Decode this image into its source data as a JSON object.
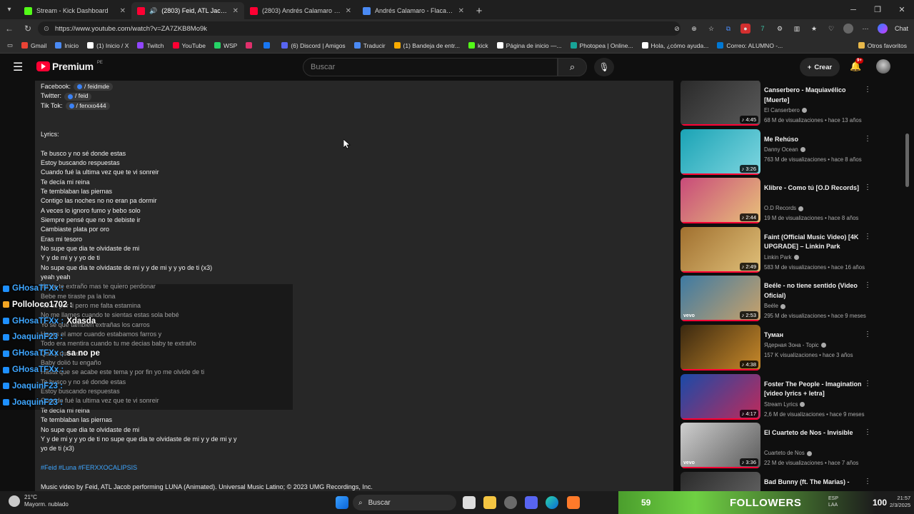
{
  "browser": {
    "tabs": [
      {
        "title": "Stream - Kick Dashboard",
        "icon": "kick-icon",
        "color": "#53fc18",
        "active": false
      },
      {
        "title": "(2803) Feid, ATL Jacob - Luna",
        "icon": "youtube-icon",
        "color": "#ff0033",
        "active": true
      },
      {
        "title": "(2803) Andrés Calamaro - Flaca (V",
        "icon": "youtube-icon",
        "color": "#ff0033",
        "active": false
      },
      {
        "title": "Andrés Calamaro - Flaca letra - Bú",
        "icon": "search-icon",
        "color": "#4a8af4",
        "active": false
      }
    ],
    "url": "https://www.youtube.com/watch?v=ZA7ZKB8Mo9k",
    "chat_label": "Chat",
    "bookmarks": [
      {
        "label": "Gmail",
        "color": "#ea4335"
      },
      {
        "label": "Inicio",
        "color": "#4a8af4"
      },
      {
        "label": "(1) Inicio / X",
        "color": "#ffffff"
      },
      {
        "label": "Twitch",
        "color": "#9146ff"
      },
      {
        "label": "YouTube",
        "color": "#ff0033"
      },
      {
        "label": "WSP",
        "color": "#25d366"
      },
      {
        "label": "",
        "color": "#e1306c"
      },
      {
        "label": "",
        "color": "#1877f2"
      },
      {
        "label": "(6) Discord | Amigos",
        "color": "#5865f2"
      },
      {
        "label": "Traducir",
        "color": "#4a8af4"
      },
      {
        "label": "(1) Bandeja de entr...",
        "color": "#f9ab00"
      },
      {
        "label": "kick",
        "color": "#53fc18"
      },
      {
        "label": "Página de inicio —...",
        "color": "#ffffff"
      },
      {
        "label": "Photopea | Online...",
        "color": "#18a497"
      },
      {
        "label": "Hola, ¿cómo ayuda...",
        "color": "#ffffff"
      },
      {
        "label": "Correo: ALUMNO -...",
        "color": "#0078d4"
      }
    ],
    "other_favorites": "Otros favoritos"
  },
  "youtube": {
    "logo": "Premium",
    "region": "PE",
    "search_placeholder": "Buscar",
    "create_label": "Crear",
    "notif_count": "9+"
  },
  "description": {
    "social": [
      {
        "label": "Facebook:",
        "chip": "/ feidmde"
      },
      {
        "label": "Twitter:",
        "chip": "/ feid"
      },
      {
        "label": "Tik Tok:",
        "chip": "/ ferxxo444"
      }
    ],
    "lyrics_heading": "Lyrics:",
    "lyrics": [
      "Te busco y no sé donde estas",
      "Estoy buscando respuestas",
      "Cuando fué la ultima vez que te vi sonreir",
      "Te decía mi reina",
      "Te temblaban las piernas",
      "Contigo las noches no no eran pa dormir",
      "A veces lo ignoro fumo y bebo solo",
      "Siempre pensé que no te debiste ir",
      "Cambiaste plata por oro",
      "Eras mi tesoro",
      "No supe que dia te olvidaste de mi",
      "Y y de mi y y yo de ti",
      "No supe que dia te olvidaste de mi y y de mi y y yo de ti (x3)",
      "yeah yeah",
      "Ya no te extraño mas te quiero perdonar",
      "Bebe me tiraste pa la lona",
      "No es por ti pero me falta estamina",
      "No me llames cuando te sientas estas sola bebé",
      "Yo se que también extrañas los carros",
      "Haces el amor cuando estabamos farros y",
      "Todo era mentira cuando tu me decias baby te extraño",
      "Que y que bebé",
      "Baby dolió tu engaño",
      "Hasta que se acabe este tema y por fin yo me olvide de ti",
      "Te busco y no sé donde estas",
      "Estoy buscando respuestas",
      "Cuando fué la ultima vez que te vi sonreir",
      "Te decía mi reina",
      "Te temblaban las piernas",
      "No supe que dia te olvidaste de mi",
      "Y y de mi y y yo de ti no supe que dia te olvidaste de mi y y de mi y y",
      "yo de ti (x3)"
    ],
    "hashtags": "#Feid #Luna #FERXXOCALIPSIS",
    "footer": "Music video by Feid, ATL Jacob performing LUNA (Animated). Universal Music Latino; © 2023 UMG Recordings, Inc."
  },
  "recommendations": [
    {
      "title": "Canserbero - Maquiavélico [Muerte]",
      "channel": "El Canserbero",
      "meta": "68 M de visualizaciones • hace 13 años",
      "duration": "4:45",
      "colors": [
        "#2a2a2a",
        "#5a5a5a"
      ],
      "vevo": false
    },
    {
      "title": "Me Rehúso",
      "channel": "Danny Ocean",
      "meta": "763 M de visualizaciones • hace 8 años",
      "duration": "3:26",
      "colors": [
        "#1aa3b5",
        "#7fd6e0"
      ],
      "vevo": false
    },
    {
      "title": "Klibre - Como tú [O.D Records]",
      "channel": "O.D Records",
      "meta": "19 M de visualizaciones • hace 8 años",
      "duration": "2:44",
      "colors": [
        "#c84a7a",
        "#e8c27a"
      ],
      "vevo": false
    },
    {
      "title": "Faint (Official Music Video) [4K UPGRADE] – Linkin Park",
      "channel": "Linkin Park",
      "meta": "583 M de visualizaciones • hace 16 años",
      "duration": "2:49",
      "colors": [
        "#a0702f",
        "#e0c07a"
      ],
      "vevo": false
    },
    {
      "title": "Beéle - no tiene sentido (Video Oficial)",
      "channel": "Beéle",
      "meta": "295 M de visualizaciones • hace 9 meses",
      "duration": "2:53",
      "colors": [
        "#3d7aa3",
        "#c9a26a"
      ],
      "vevo": true
    },
    {
      "title": "Туман",
      "channel": "Ядерная Зона - Topic",
      "meta": "157 K visualizaciones • hace 3 años",
      "duration": "4:38",
      "colors": [
        "#3a2810",
        "#c98a2a"
      ],
      "vevo": false
    },
    {
      "title": "Foster The People - Imagination [video lyrics + letra]",
      "channel": "Stream Lyrics",
      "meta": "2,6 M de visualizaciones • hace 9 meses",
      "duration": "4:17",
      "colors": [
        "#1a4aa8",
        "#c02a5a"
      ],
      "vevo": false
    },
    {
      "title": "El Cuarteto de Nos - Invisible",
      "channel": "Cuarteto de Nos",
      "meta": "22 M de visualizaciones • hace 7 años",
      "duration": "3:36",
      "colors": [
        "#cfcfcf",
        "#5a5a5a"
      ],
      "vevo": true
    },
    {
      "title": "Bad Bunny (ft. The Marias) -",
      "channel": "",
      "meta": "",
      "duration": "",
      "colors": [
        "#2a2a2a",
        "#6a6a6a"
      ],
      "vevo": false
    }
  ],
  "chat_overlay": [
    {
      "user": "GHosaTFXx :",
      "msg": "",
      "color": "#3ea6ff",
      "badge": "#1e90ff"
    },
    {
      "user": "Polloloco1702 :",
      "msg": "",
      "color": "#ffffff",
      "badge": "#f5a623"
    },
    {
      "user": "GHosaTFXx :",
      "msg": "Xdasda",
      "color": "#3ea6ff",
      "badge": "#1e90ff"
    },
    {
      "user": "JoaquinF23 :",
      "msg": "",
      "color": "#3ea6ff",
      "badge": "#1e90ff"
    },
    {
      "user": "GHosaTFXx :",
      "msg": "sa no pe",
      "color": "#3ea6ff",
      "badge": "#1e90ff"
    },
    {
      "user": "GHosaTFXx :",
      "msg": "",
      "color": "#3ea6ff",
      "badge": "#1e90ff"
    },
    {
      "user": "JoaquinF23 :",
      "msg": "",
      "color": "#3ea6ff",
      "badge": "#1e90ff"
    },
    {
      "user": "JoaquinF23 :",
      "msg": "",
      "color": "#3ea6ff",
      "badge": "#1e90ff"
    }
  ],
  "taskbar": {
    "temp": "21°C",
    "weather": "Mayorm. nublado",
    "search": "Buscar",
    "followers_count": "59",
    "followers_label": "FOLLOWERS",
    "followers_goal": "100",
    "lang": "ESP",
    "lang2": "LAA",
    "time": "21:57",
    "date": "2/3/2025"
  }
}
